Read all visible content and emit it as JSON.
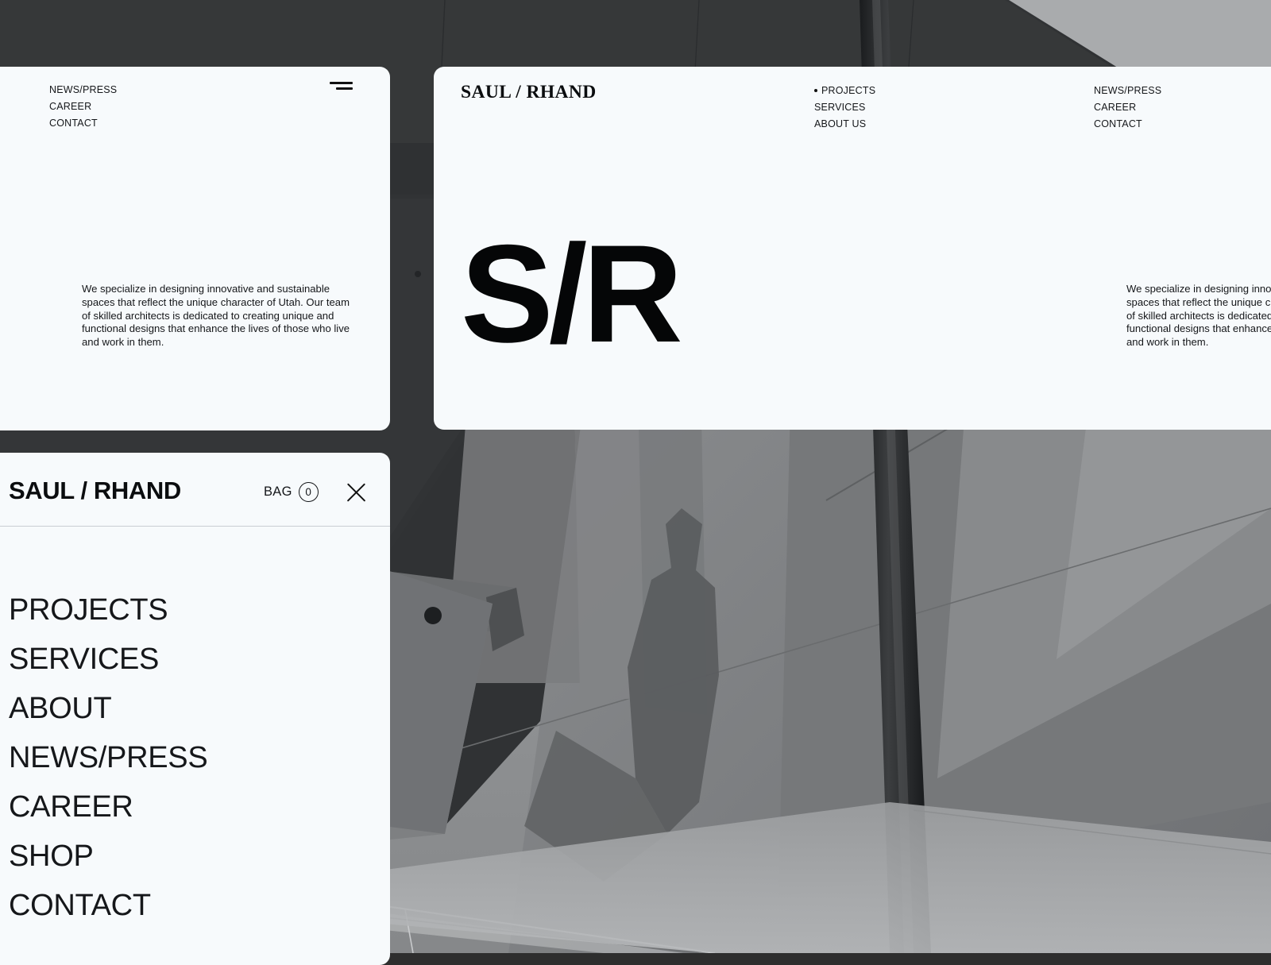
{
  "brand": {
    "serif_wordmark": "SAUL / RHAND",
    "sans_wordmark": "SAUL / RHAND",
    "monogram": "S/R"
  },
  "left_card": {
    "nav": [
      {
        "label": "NEWS/PRESS"
      },
      {
        "label": "CAREER"
      },
      {
        "label": "CONTACT"
      }
    ],
    "menu_icon": "hamburger-icon",
    "blurb": "We specialize in designing innovative and sustainable spaces that reflect the unique character of Utah. Our team of skilled architects is dedicated to creating unique and functional designs that enhance the lives of those who live and work in them."
  },
  "hero_card": {
    "nav_primary": [
      {
        "label": "PROJECTS",
        "marker": "•",
        "active": true
      },
      {
        "label": "SERVICES",
        "marker": "",
        "active": false
      },
      {
        "label": "ABOUT US",
        "marker": "",
        "active": false
      }
    ],
    "nav_secondary": [
      {
        "label": "NEWS/PRESS"
      },
      {
        "label": "CAREER"
      },
      {
        "label": "CONTACT"
      }
    ],
    "blurb": "We specialize in designing innovative and sustainable spaces that reflect the unique character of Utah. Our team of skilled architects is dedicated to creating unique and functional designs that enhance the lives of those who live and work in them."
  },
  "menu_panel": {
    "bag_label": "BAG",
    "bag_count": "0",
    "close_icon": "close-icon",
    "items": [
      {
        "label": "PROJECTS"
      },
      {
        "label": "SERVICES"
      },
      {
        "label": "ABOUT"
      },
      {
        "label": "NEWS/PRESS"
      },
      {
        "label": "CAREER"
      },
      {
        "label": "SHOP"
      },
      {
        "label": "CONTACT"
      }
    ]
  },
  "colors": {
    "card_bg": "#f7fafc",
    "ink": "#15171a",
    "ink_strong": "#050607",
    "rule": "#c9cdd2",
    "photo_dark": "#2e2e2e"
  }
}
